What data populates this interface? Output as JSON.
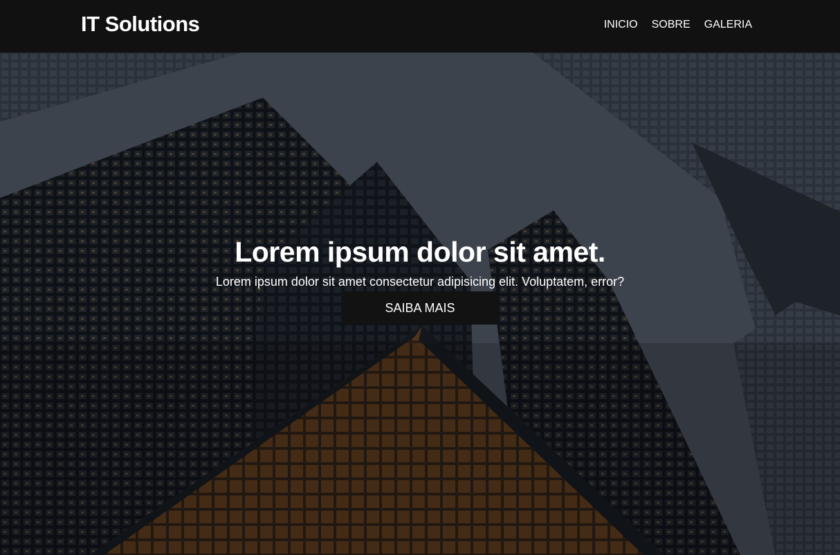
{
  "navbar": {
    "brand": "IT Solutions",
    "links": [
      "INICIO",
      "SOBRE",
      "GALERIA"
    ]
  },
  "hero": {
    "title": "Lorem ipsum dolor sit amet.",
    "subtitle": "Lorem ipsum dolor sit amet consectetur adipisicing elit. Voluptatem, error?",
    "button_label": "SAIBA MAIS",
    "background_description_icon": "skyscrapers-background"
  },
  "colors": {
    "navbar_bg": "#111111",
    "button_bg": "#121212",
    "text": "#ffffff"
  }
}
